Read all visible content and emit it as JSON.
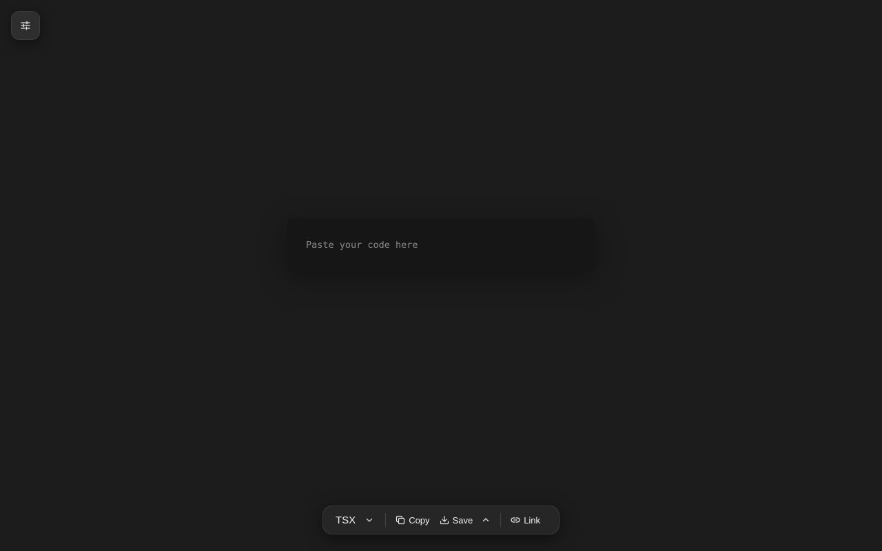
{
  "settings": {
    "icon": "sliders-icon"
  },
  "editor": {
    "placeholder": "Paste your code here",
    "value": ""
  },
  "toolbar": {
    "language": {
      "label": "TSX",
      "icon": "chevron-down-icon"
    },
    "copy": {
      "label": "Copy",
      "icon": "copy-icon"
    },
    "save": {
      "label": "Save",
      "icon": "download-icon"
    },
    "more": {
      "icon": "chevron-up-icon"
    },
    "link": {
      "label": "Link",
      "icon": "link-icon"
    }
  },
  "colors": {
    "background": "#1c1c1c",
    "editor_background": "#161616",
    "toolbar_background": "#262626",
    "text": "#f0f0f0",
    "placeholder": "#8a8a8a"
  }
}
